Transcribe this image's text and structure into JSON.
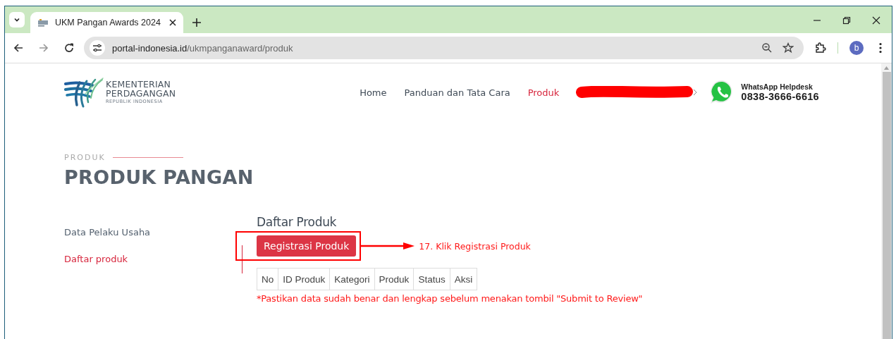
{
  "browser": {
    "tab_title": "UKM Pangan Awards 2024",
    "url_host": "portal-indonesia.id",
    "url_path": "/ukmpanganaward/produk",
    "profile_initial": "b"
  },
  "logo": {
    "line1": "KEMENTERIAN",
    "line2": "PERDAGANGAN",
    "line3": "REPUBLIK INDONESIA"
  },
  "nav": [
    {
      "label": "Home",
      "selected": false
    },
    {
      "label": "Panduan dan Tata Cara",
      "selected": false
    },
    {
      "label": "Produk",
      "selected": true
    }
  ],
  "helpdesk": {
    "label": "WhatsApp Helpdesk",
    "phone": "0838-3666-6616"
  },
  "breadcrumb": "PRODUK",
  "page_title": "PRODUK PANGAN",
  "sidebar": [
    {
      "label": "Data Pelaku Usaha",
      "selected": false
    },
    {
      "label": "Daftar produk",
      "selected": true
    }
  ],
  "section_title": "Daftar Produk",
  "register_button": "Registrasi Produk",
  "annotation": "17. Klik Registrasi Produk",
  "table": {
    "columns": [
      "No",
      "ID Produk",
      "Kategori",
      "Produk",
      "Status",
      "Aksi"
    ]
  },
  "note": "*Pastikan data sudah benar dan lengkap sebelum menakan tombil \"Submit to Review\""
}
